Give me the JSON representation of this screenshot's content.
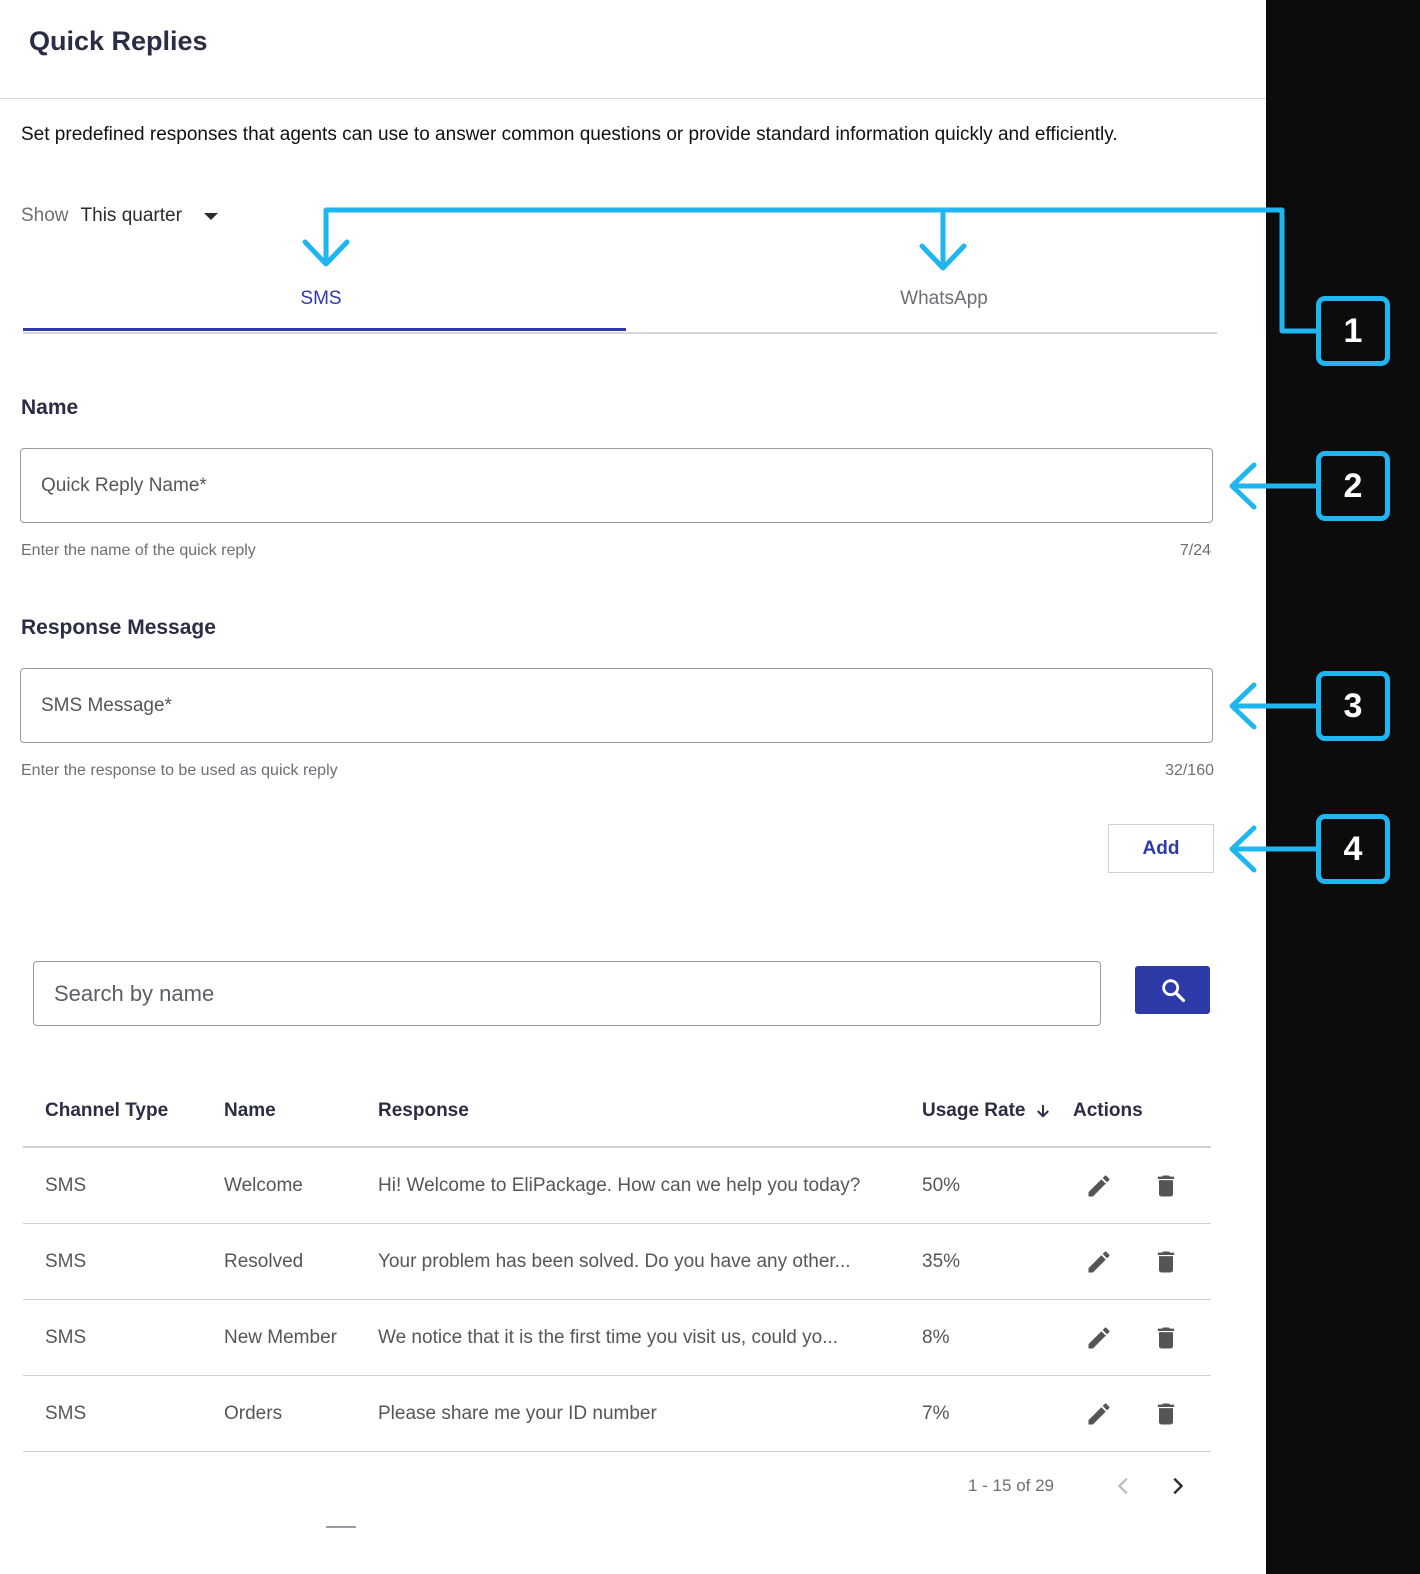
{
  "header": {
    "title": "Quick Replies"
  },
  "description": "Set predefined responses that agents can use to answer common questions or provide standard information quickly and efficiently.",
  "filter": {
    "label": "Show",
    "value": "This quarter"
  },
  "tabs": [
    {
      "label": "SMS",
      "active": true
    },
    {
      "label": "WhatsApp",
      "active": false
    }
  ],
  "name_section": {
    "label": "Name",
    "placeholder": "Quick Reply Name*",
    "helper": "Enter the name of the quick reply",
    "counter": "7/24"
  },
  "response_section": {
    "label": "Response Message",
    "placeholder": "SMS Message*",
    "helper": "Enter the response to be used as quick reply",
    "counter": "32/160"
  },
  "add_button": "Add",
  "search": {
    "placeholder": "Search by name"
  },
  "table": {
    "headers": {
      "channel": "Channel Type",
      "name": "Name",
      "response": "Response",
      "usage": "Usage Rate",
      "actions": "Actions"
    },
    "rows": [
      {
        "channel": "SMS",
        "name": "Welcome",
        "response": "Hi! Welcome to EliPackage. How can we help you today?",
        "usage": "50%"
      },
      {
        "channel": "SMS",
        "name": "Resolved",
        "response": "Your problem has been solved. Do you have any other...",
        "usage": "35%"
      },
      {
        "channel": "SMS",
        "name": "New Member",
        "response": "We notice that it is the first time you visit us, could yo...",
        "usage": "8%"
      },
      {
        "channel": "SMS",
        "name": "Orders",
        "response": "Please share me your ID number",
        "usage": "7%"
      }
    ]
  },
  "pagination": {
    "range": "1 - 15 of 29"
  },
  "annotations": [
    "1",
    "2",
    "3",
    "4"
  ],
  "colors": {
    "accent": "#2d3aa8",
    "annotation": "#1fb5f0",
    "side_panel": "#0c0c0c"
  }
}
